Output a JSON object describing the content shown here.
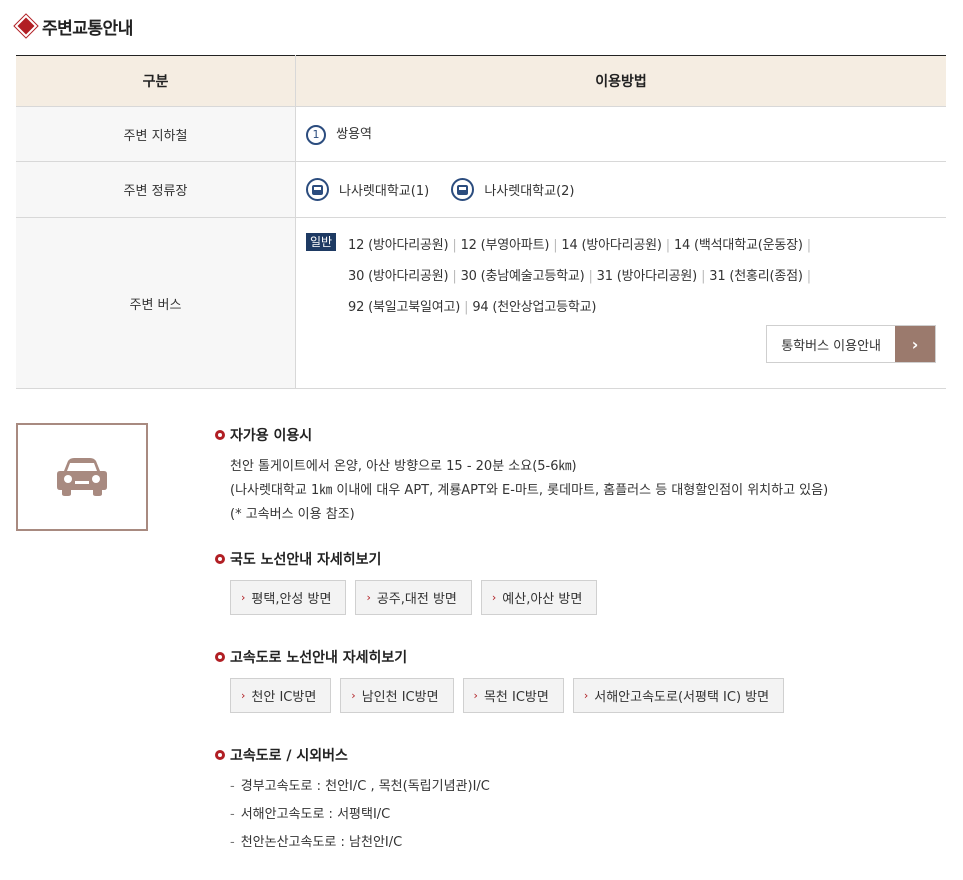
{
  "page_title": "주변교통안내",
  "table": {
    "headers": [
      "구분",
      "이용방법"
    ],
    "subway": {
      "label": "주변 지하철",
      "line_number": "1",
      "station": "쌍용역"
    },
    "stop": {
      "label": "주변 정류장",
      "stops": [
        "나사렛대학교(1)",
        "나사렛대학교(2)"
      ]
    },
    "bus": {
      "label": "주변 버스",
      "badge": "일반",
      "rows": [
        [
          "12 (방아다리공원)",
          "12 (부영아파트)",
          "14 (방아다리공원)",
          "14 (백석대학교(운동장)"
        ],
        [
          "30 (방아다리공원)",
          "30 (충남예술고등학교)",
          "31 (방아다리공원)",
          "31 (천홍리(종점)"
        ],
        [
          "92 (북일고북일여고)",
          "94 (천안상업고등학교)"
        ]
      ],
      "row_trailing_separator": [
        true,
        true,
        false
      ],
      "shuttle_button": "통학버스 이용안내",
      "shuttle_arrow": "›"
    }
  },
  "car_icon": "car-icon",
  "sections": {
    "car": {
      "title": "자가용 이용시",
      "lines": [
        "천안 톨게이트에서 온양, 아산 방향으로 15 - 20분 소요(5-6㎞)",
        "(나사렛대학교 1㎞ 이내에 대우 APT, 계룡APT와 E-마트, 롯데마트, 홈플러스 등 대형할인점이 위치하고 있음)",
        "(* 고속버스 이용 참조)"
      ]
    },
    "national_road": {
      "title": "국도 노선안내 자세히보기",
      "buttons": [
        "평택,안성 방면",
        "공주,대전 방면",
        "예산,아산 방면"
      ]
    },
    "expressway": {
      "title": "고속도로 노선안내 자세히보기",
      "buttons": [
        "천안 IC방면",
        "남인천 IC방면",
        "목천 IC방면",
        "서해안고속도로(서평택 IC) 방면"
      ]
    },
    "express_bus": {
      "title": "고속도로 / 시외버스",
      "items": [
        "경부고속도로 : 천안I/C , 목천(독립기념관)I/C",
        "서해안고속도로 : 서평택I/C",
        "천안논산고속도로 : 남천안I/C"
      ]
    }
  },
  "colors": {
    "accent_red": "#b11f24",
    "navy": "#1e3a63",
    "header_bg": "#f5ede2",
    "brown": "#9b7a6d"
  }
}
